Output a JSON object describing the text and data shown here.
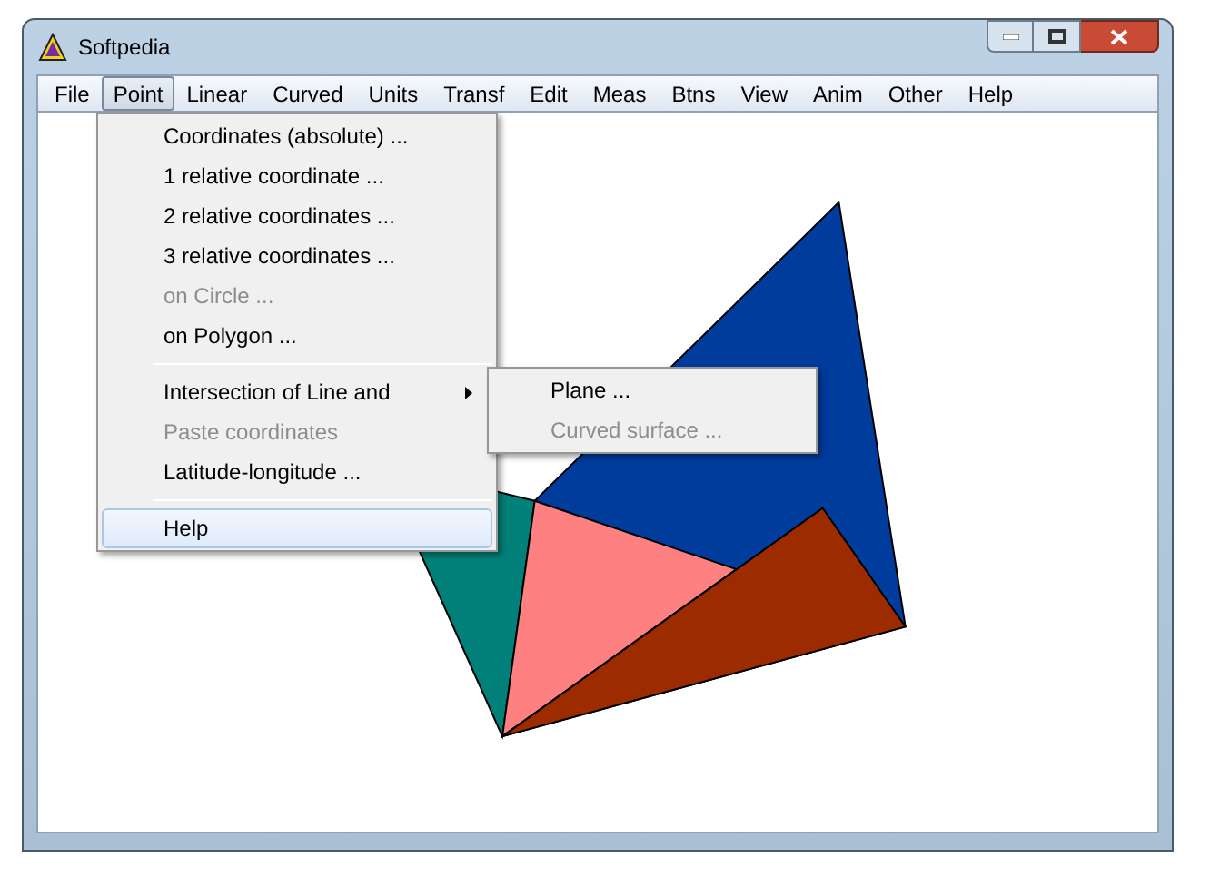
{
  "window": {
    "title": "Softpedia"
  },
  "menubar": [
    {
      "label": "File",
      "selected": false
    },
    {
      "label": "Point",
      "selected": true
    },
    {
      "label": "Linear",
      "selected": false
    },
    {
      "label": "Curved",
      "selected": false
    },
    {
      "label": "Units",
      "selected": false
    },
    {
      "label": "Transf",
      "selected": false
    },
    {
      "label": "Edit",
      "selected": false
    },
    {
      "label": "Meas",
      "selected": false
    },
    {
      "label": "Btns",
      "selected": false
    },
    {
      "label": "View",
      "selected": false
    },
    {
      "label": "Anim",
      "selected": false
    },
    {
      "label": "Other",
      "selected": false
    },
    {
      "label": "Help",
      "selected": false
    }
  ],
  "point_menu": [
    {
      "kind": "item",
      "label": "Coordinates (absolute) ...",
      "disabled": false,
      "selected": false
    },
    {
      "kind": "item",
      "label": "1 relative coordinate ...",
      "disabled": false,
      "selected": false
    },
    {
      "kind": "item",
      "label": "2 relative coordinates ...",
      "disabled": false,
      "selected": false
    },
    {
      "kind": "item",
      "label": "3 relative coordinates ...",
      "disabled": false,
      "selected": false
    },
    {
      "kind": "item",
      "label": "on Circle ...",
      "disabled": true,
      "selected": false
    },
    {
      "kind": "item",
      "label": "on Polygon ...",
      "disabled": false,
      "selected": false
    },
    {
      "kind": "separator"
    },
    {
      "kind": "submenu",
      "label": "Intersection of Line and",
      "disabled": false,
      "selected": false,
      "children": [
        {
          "label": "Plane ...",
          "disabled": false
        },
        {
          "label": "Curved surface ...",
          "disabled": true
        }
      ]
    },
    {
      "kind": "item",
      "label": "Paste coordinates",
      "disabled": true,
      "selected": false
    },
    {
      "kind": "item",
      "label": "Latitude-longitude ...",
      "disabled": false,
      "selected": false
    },
    {
      "kind": "separator"
    },
    {
      "kind": "item",
      "label": "Help",
      "disabled": false,
      "selected": true
    }
  ]
}
